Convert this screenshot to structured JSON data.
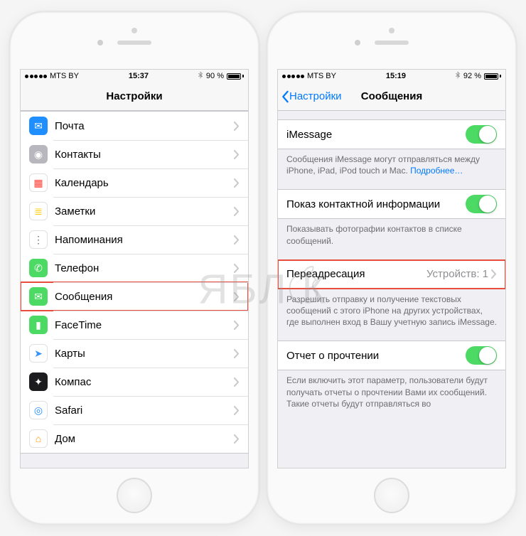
{
  "left": {
    "status": {
      "carrier": "MTS BY",
      "time": "15:37",
      "battery_pct": "90 %",
      "battery_fill": 90
    },
    "nav": {
      "title": "Настройки"
    },
    "items": [
      {
        "label": "Почта",
        "icon_bg": "#1f8eff",
        "icon_glyph": "✉",
        "name": "mail"
      },
      {
        "label": "Контакты",
        "icon_bg": "#b7b7bd",
        "icon_glyph": "◉",
        "name": "contacts"
      },
      {
        "label": "Календарь",
        "icon_bg": "#ffffff",
        "icon_glyph": "▦",
        "icon_fg": "#ff3b30",
        "name": "calendar",
        "border": true
      },
      {
        "label": "Заметки",
        "icon_bg": "#ffffff",
        "icon_glyph": "≣",
        "icon_fg": "#ffcc00",
        "name": "notes",
        "border": true
      },
      {
        "label": "Напоминания",
        "icon_bg": "#ffffff",
        "icon_glyph": "⋮",
        "icon_fg": "#666",
        "name": "reminders",
        "border": true
      },
      {
        "label": "Телефон",
        "icon_bg": "#4cd964",
        "icon_glyph": "✆",
        "name": "phone"
      },
      {
        "label": "Сообщения",
        "icon_bg": "#4cd964",
        "icon_glyph": "✉",
        "name": "messages",
        "highlight": true
      },
      {
        "label": "FaceTime",
        "icon_bg": "#4cd964",
        "icon_glyph": "▮",
        "name": "facetime"
      },
      {
        "label": "Карты",
        "icon_bg": "#ffffff",
        "icon_glyph": "➤",
        "icon_fg": "#3793ff",
        "name": "maps",
        "border": true
      },
      {
        "label": "Компас",
        "icon_bg": "#1c1c1e",
        "icon_glyph": "✦",
        "name": "compass"
      },
      {
        "label": "Safari",
        "icon_bg": "#ffffff",
        "icon_glyph": "◎",
        "icon_fg": "#1f8eff",
        "name": "safari",
        "border": true
      },
      {
        "label": "Дом",
        "icon_bg": "#ffffff",
        "icon_glyph": "⌂",
        "icon_fg": "#ff9500",
        "name": "home",
        "border": true
      }
    ]
  },
  "right": {
    "status": {
      "carrier": "MTS BY",
      "time": "15:19",
      "battery_pct": "92 %",
      "battery_fill": 92
    },
    "nav": {
      "back": "Настройки",
      "title": "Сообщения"
    },
    "groups": [
      {
        "cells": [
          {
            "label": "iMessage",
            "toggle": true,
            "name": "imessage-toggle"
          }
        ],
        "footer": "Сообщения iMessage могут отправляться между iPhone, iPad, iPod touch и Mac. ",
        "footer_link": "Подробнее…"
      },
      {
        "cells": [
          {
            "label": "Показ контактной информации",
            "toggle": true,
            "name": "show-contact-toggle"
          }
        ],
        "footer": "Показывать фотографии контактов в списке сообщений."
      },
      {
        "cells": [
          {
            "label": "Переадресация",
            "detail": "Устройств: 1",
            "chevron": true,
            "name": "text-forwarding",
            "highlight": true
          }
        ],
        "footer": "Разрешить отправку и получение текстовых сообщений с этого iPhone на других устройствах, где выполнен вход в Вашу учетную запись iMessage."
      },
      {
        "cells": [
          {
            "label": "Отчет о прочтении",
            "toggle": true,
            "name": "read-receipts-toggle"
          }
        ],
        "footer": "Если включить этот параметр, пользователи будут получать отчеты о прочтении Вами их сообщений. Такие отчеты будут отправляться во"
      }
    ]
  },
  "watermark": "ЯБЛ  К"
}
